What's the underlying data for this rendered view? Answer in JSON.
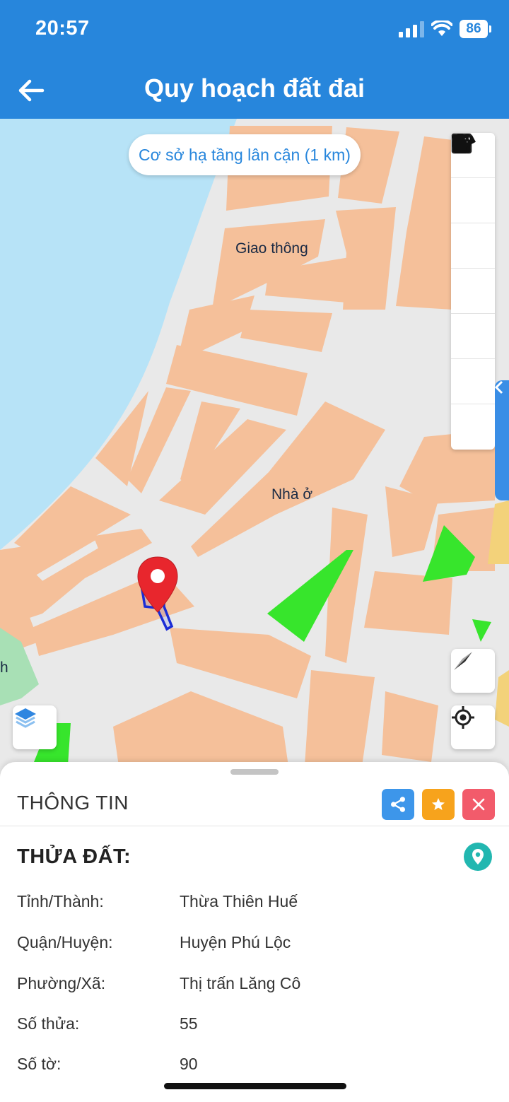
{
  "status_bar": {
    "time": "20:57",
    "battery": "86",
    "icons": [
      "cellular-signal-icon",
      "wifi-icon",
      "battery-icon"
    ]
  },
  "app_bar": {
    "title": "Quy hoạch đất đai",
    "back_icon": "arrow-left-icon",
    "background": "#2786dc"
  },
  "map": {
    "infra_button": "Cơ sở hạ tầng lân cận (1 km)",
    "labels": {
      "giao_thong": "Giao thông",
      "nha_o": "Nhà ở",
      "edge": "h"
    },
    "toolbar_icons": [
      "image-layer-icon",
      "share-icon",
      "info-icon",
      "camera-icon",
      "polygon-draw-icon",
      "ruler-icon",
      "trash-icon"
    ],
    "colors": {
      "water": "#b7e3f7",
      "residential": "#f5c09a",
      "road": "#eaeaea",
      "green": "#37e52c",
      "parcel_outline": "#1b2dd6",
      "marker": "#e8262d"
    }
  },
  "sheet": {
    "header_title": "THÔNG TIN",
    "header_buttons": [
      {
        "icon": "share-icon",
        "color": "#3d96ea"
      },
      {
        "icon": "star-icon",
        "color": "#f7a31c"
      },
      {
        "icon": "close-icon",
        "color": "#f25b6b"
      }
    ],
    "section_title": "THỬA ĐẤT:",
    "rows": [
      {
        "label": "Tỉnh/Thành:",
        "value": "Thừa Thiên Huế"
      },
      {
        "label": "Quận/Huyện:",
        "value": "Huyện Phú Lộc"
      },
      {
        "label": "Phường/Xã:",
        "value": "Thị trấn Lăng Cô"
      },
      {
        "label": "Số thửa:",
        "value": "55"
      },
      {
        "label": "Số tờ:",
        "value": "90"
      }
    ]
  }
}
